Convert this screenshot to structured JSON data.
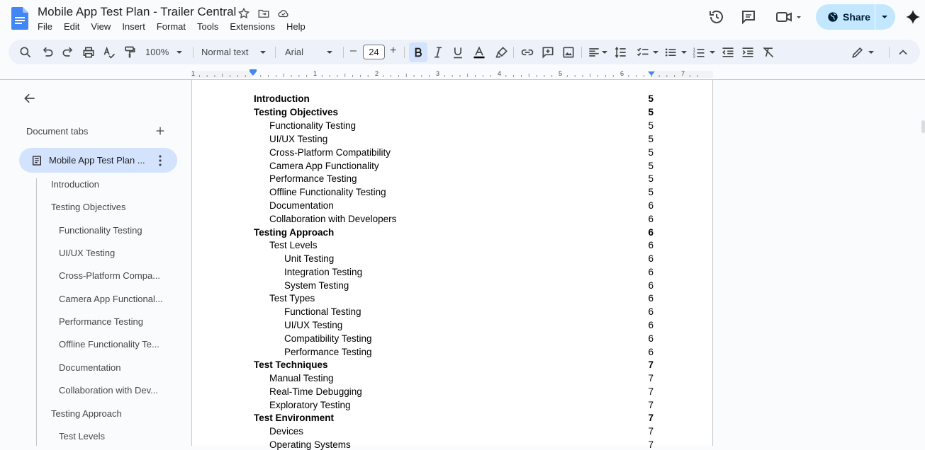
{
  "app": {
    "title": "Mobile App Test Plan - Trailer Central",
    "menu": [
      "File",
      "Edit",
      "View",
      "Insert",
      "Format",
      "Tools",
      "Extensions",
      "Help"
    ],
    "share_label": "Share"
  },
  "toolbar": {
    "zoom": "100%",
    "style": "Normal text",
    "font": "Arial",
    "font_size": "24",
    "minus": "–",
    "plus": "+"
  },
  "ruler": {
    "numbers": [
      "1",
      "1",
      "2",
      "3",
      "4",
      "5",
      "6",
      "7"
    ]
  },
  "sidebar": {
    "header": "Document tabs",
    "add": "+",
    "active_tab": "Mobile App Test Plan ...",
    "outline": [
      "Introduction",
      "Testing Objectives",
      "Functionality Testing",
      "UI/UX Testing",
      "Cross-Platform Compa...",
      "Camera App Functional...",
      "Performance Testing",
      "Offline Functionality Te...",
      "Documentation",
      "Collaboration with Dev...",
      "Testing Approach",
      "Test Levels"
    ]
  },
  "toc": [
    {
      "t": "Introduction",
      "p": "5"
    },
    {
      "t": "Testing Objectives",
      "p": "5"
    },
    {
      "t": "Functionality Testing",
      "p": "5"
    },
    {
      "t": "UI/UX Testing",
      "p": "5"
    },
    {
      "t": "Cross-Platform Compatibility",
      "p": "5"
    },
    {
      "t": "Camera App Functionality",
      "p": "5"
    },
    {
      "t": "Performance Testing",
      "p": "5"
    },
    {
      "t": "Offline Functionality Testing",
      "p": "5"
    },
    {
      "t": "Documentation",
      "p": "6"
    },
    {
      "t": "Collaboration with Developers",
      "p": "6"
    },
    {
      "t": "Testing Approach",
      "p": "6"
    },
    {
      "t": "Test Levels",
      "p": "6"
    },
    {
      "t": "Unit Testing",
      "p": "6"
    },
    {
      "t": "Integration Testing",
      "p": "6"
    },
    {
      "t": "System Testing",
      "p": "6"
    },
    {
      "t": "Test Types",
      "p": "6"
    },
    {
      "t": "Functional Testing",
      "p": "6"
    },
    {
      "t": "UI/UX Testing",
      "p": "6"
    },
    {
      "t": "Compatibility Testing",
      "p": "6"
    },
    {
      "t": "Performance Testing",
      "p": "6"
    },
    {
      "t": "Test Techniques",
      "p": "7"
    },
    {
      "t": "Manual Testing",
      "p": "7"
    },
    {
      "t": "Real-Time Debugging",
      "p": "7"
    },
    {
      "t": "Exploratory Testing",
      "p": "7"
    },
    {
      "t": "Test Environment",
      "p": "7"
    },
    {
      "t": "Devices",
      "p": "7"
    },
    {
      "t": "Operating Systems",
      "p": "7"
    }
  ]
}
